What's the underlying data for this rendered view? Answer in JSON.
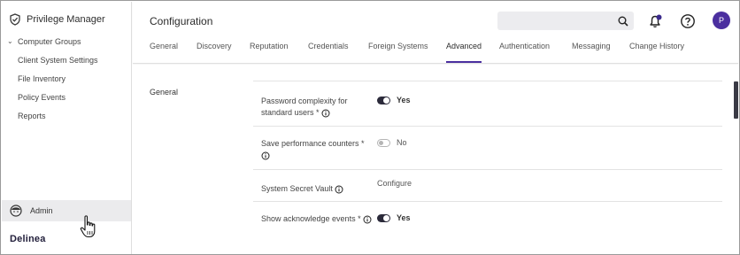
{
  "app": {
    "name": "Privilege Manager",
    "footer_brand": "Delinea"
  },
  "sidebar": {
    "items": [
      {
        "label": "Computer Groups",
        "expandable": true
      },
      {
        "label": "Client System Settings"
      },
      {
        "label": "File Inventory"
      },
      {
        "label": "Policy Events"
      },
      {
        "label": "Reports"
      }
    ],
    "admin_label": "Admin"
  },
  "header": {
    "title": "Configuration",
    "search": {
      "value": "",
      "placeholder": ""
    },
    "user_initial": "P",
    "tabs": [
      {
        "label": "General"
      },
      {
        "label": "Discovery"
      },
      {
        "label": "Reputation"
      },
      {
        "label": "Credentials"
      },
      {
        "label": "Foreign Systems"
      },
      {
        "label": "Advanced",
        "active": true
      },
      {
        "label": "Authentication"
      },
      {
        "label": "Messaging"
      },
      {
        "label": "Change History"
      }
    ]
  },
  "main": {
    "section_label": "General",
    "settings": [
      {
        "label": "Password complexity for standard users *",
        "control": "toggle",
        "state": "on",
        "value": "Yes"
      },
      {
        "label": "Save performance counters *",
        "control": "toggle",
        "state": "off",
        "value": "No"
      },
      {
        "label": "System Secret Vault",
        "control": "link",
        "value": "Configure"
      },
      {
        "label": "Show acknowledge events *",
        "control": "toggle",
        "state": "on",
        "value": "Yes"
      }
    ]
  },
  "colors": {
    "accent": "#4b2f9f",
    "toggle_on": "#2b2a3a",
    "notification_dot": "#3b2a8c"
  }
}
